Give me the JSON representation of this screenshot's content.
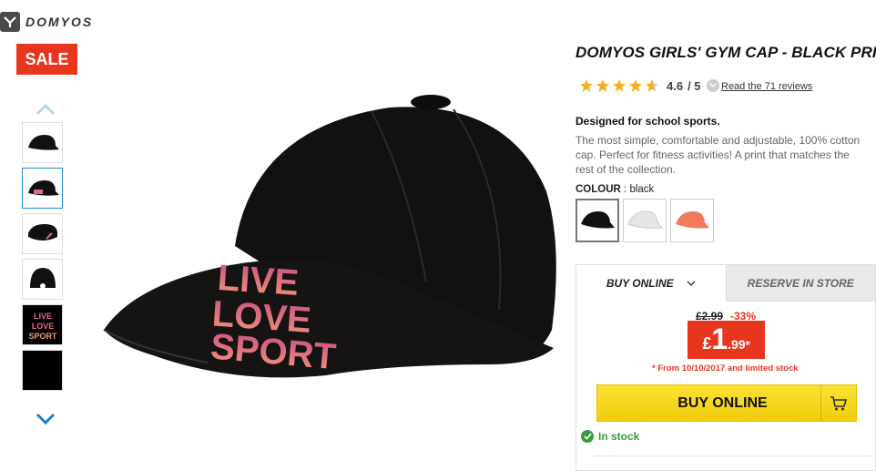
{
  "brand": {
    "name": "DOMYOS"
  },
  "badge": {
    "sale": "SALE"
  },
  "product": {
    "title": "DOMYOS GIRLS' GYM CAP - BLACK PRINT",
    "rating_value": "4.6",
    "rating_max": "/ 5",
    "rating_fraction": 0.92,
    "reviews_link": "Read the 71 reviews",
    "tagline": "Designed for school sports.",
    "description": "The most simple, comfortable and adjustable, 100% cotton cap. Perfect for fitness activities! A print that matches the rest of the collection.",
    "colour_label": "COLOUR",
    "colour_value": "black",
    "swatches": [
      {
        "name": "black",
        "color": "#111111"
      },
      {
        "name": "white",
        "color": "#e6e6e6"
      },
      {
        "name": "coral",
        "color": "#f07a5c"
      }
    ],
    "print_text": [
      "LIVE",
      "LOVE",
      "SPORT"
    ]
  },
  "buybox": {
    "tab_buy": "BUY ONLINE",
    "tab_reserve": "RESERVE IN STORE",
    "old_price": "£2.99",
    "discount": "-33%",
    "price_currency": "£",
    "price_int": "1",
    "price_dec": ".99",
    "price_star": "*",
    "availability_note": "* From 10/10/2017 and limited stock",
    "buy_button": "BUY ONLINE",
    "stock": "In stock"
  },
  "colors": {
    "sale_red": "#e8361e",
    "buy_yellow": "#fbe233",
    "stock_green": "#3a9a3a",
    "star_gold": "#f2b01e",
    "thumb_selected": "#1e8bd6"
  }
}
